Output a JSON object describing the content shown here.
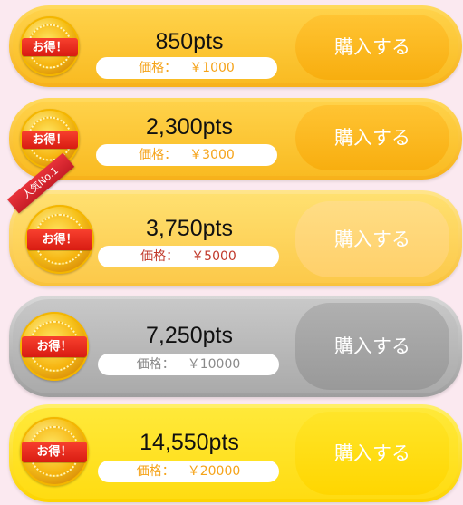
{
  "packages": [
    {
      "points": "850pts",
      "price_label": "価格：",
      "price": "￥1000",
      "button": "購入する",
      "coin": "お得！"
    },
    {
      "points": "2,300pts",
      "price_label": "価格：",
      "price": "￥3000",
      "button": "購入する",
      "coin": "お得！"
    },
    {
      "points": "3,750pts",
      "price_label": "価格：",
      "price": "￥5000",
      "button": "購入する",
      "coin": "お得！",
      "badge": "人気No.1"
    },
    {
      "points": "7,250pts",
      "price_label": "価格：",
      "price": "￥10000",
      "button": "購入する",
      "coin": "お得！"
    },
    {
      "points": "14,550pts",
      "price_label": "価格：",
      "price": "￥20000",
      "button": "購入する",
      "coin": "お得！"
    }
  ],
  "colors": {
    "background": "#fbe9f0",
    "row1": "#fcc437",
    "row2": "#fcc437",
    "row3": "#ffd45a",
    "row4": "#b9b9b9",
    "row5": "#ffe21c",
    "button_orange": "#fbb11d",
    "button_light": "#ffd46a",
    "button_gray": "#a0a0a0",
    "button_yellow": "#ffd814",
    "price_text_orange": "#f5a319",
    "price_text_red": "#c0392b",
    "price_text_gray": "#8a8a8a",
    "badge_red": "#e8323a"
  }
}
